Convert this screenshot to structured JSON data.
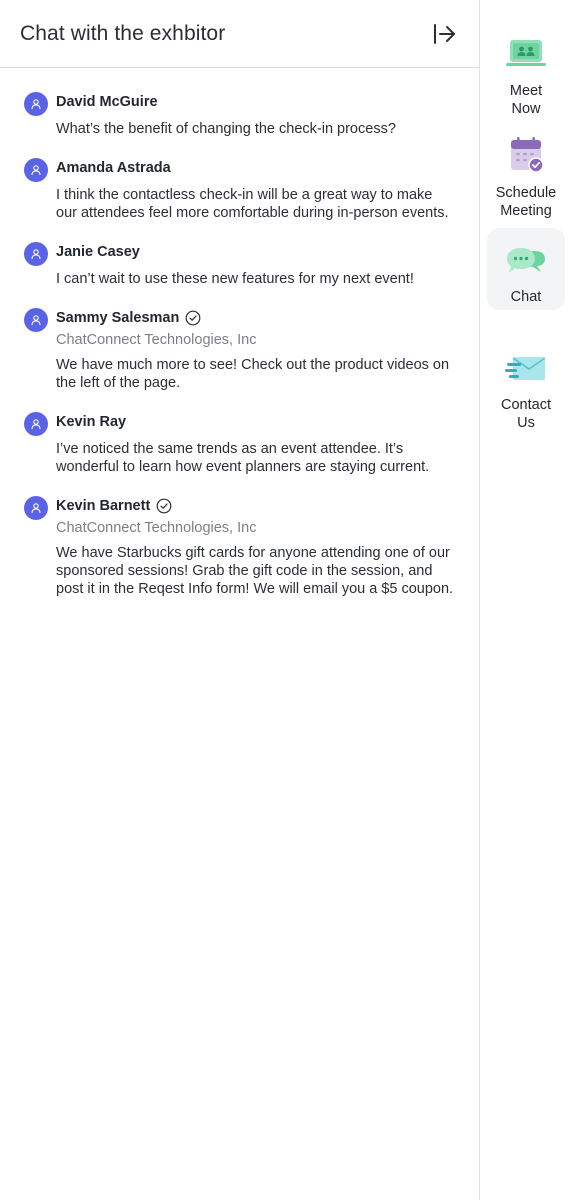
{
  "chat": {
    "title": "Chat with the exhbitor",
    "messages": [
      {
        "name": "David McGuire",
        "verified": false,
        "company": "",
        "text": "What’s the benefit of changing the check-in process?"
      },
      {
        "name": "Amanda Astrada",
        "verified": false,
        "company": "",
        "text": "I think the contactless check-in will be a great way to make our attendees feel more comfortable during in-person events."
      },
      {
        "name": "Janie Casey",
        "verified": false,
        "company": "",
        "text": "I can’t wait to use these new features for my next event!"
      },
      {
        "name": "Sammy Salesman",
        "verified": true,
        "company": "ChatConnect Technologies, Inc",
        "text": "We have much more to see! Check out the product videos on the left of the page."
      },
      {
        "name": "Kevin Ray",
        "verified": false,
        "company": "",
        "text": "I’ve noticed the same trends as an event attendee.  It’s wonderful to learn how event planners are staying current."
      },
      {
        "name": "Kevin Barnett",
        "verified": true,
        "company": "ChatConnect Technologies, Inc",
        "text": "We have Starbucks gift cards for anyone attending one of our sponsored sessions! Grab the gift code in the session, and post it in the Reqest Info form! We will email you a $5 coupon."
      }
    ]
  },
  "rail": {
    "items": [
      {
        "label_line1": "Meet",
        "label_line2": "Now",
        "icon": "meet-now-icon",
        "active": false
      },
      {
        "label_line1": "Schedule",
        "label_line2": "Meeting",
        "icon": "calendar-check-icon",
        "active": false
      },
      {
        "label_line1": "Chat",
        "label_line2": "",
        "icon": "chat-bubbles-icon",
        "active": true
      },
      {
        "label_line1": "Contact",
        "label_line2": "Us",
        "icon": "envelope-icon",
        "active": false
      }
    ]
  },
  "colors": {
    "avatar": "#5a63e6",
    "meet_green": "#6fd3a0",
    "calendar_purple": "#8b6bb8",
    "chat_green": "#8fe0b5",
    "envelope_teal": "#7fd4dd",
    "active_bg": "#f3f4f6"
  }
}
